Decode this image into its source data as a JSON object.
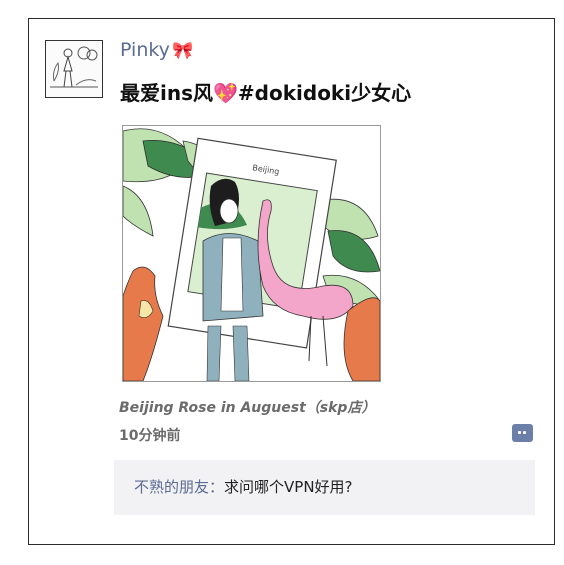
{
  "post": {
    "username": "Pinky",
    "username_emoji": "🎀",
    "caption_prefix": "最爱ins风",
    "caption_emoji": "💖",
    "caption_suffix": "#dokidoki少女心",
    "location": "Beijing Rose in Auguest（skp店）",
    "time": "10分钟前"
  },
  "photo": {
    "frame_text": "Beijing",
    "colors": {
      "leaf_green": "#bfe2b0",
      "dark_green": "#3f8a4e",
      "flamingo_pink": "#f3a6c9",
      "monkey_orange": "#e77a4a",
      "jacket_blue": "#8fb0bd"
    }
  },
  "comments": [
    {
      "user": "不熟的朋友",
      "separator": "：",
      "text": "求问哪个VPN好用?"
    }
  ],
  "colors": {
    "link": "#5b6b93",
    "comment_bg": "#f2f2f4"
  }
}
